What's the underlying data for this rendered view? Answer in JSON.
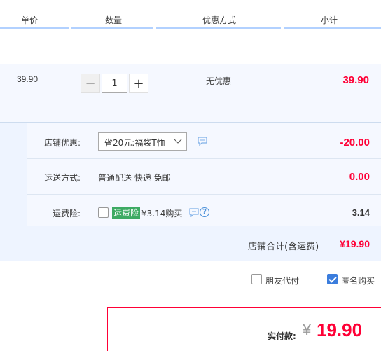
{
  "header": {
    "col_unit_price": "单价",
    "col_quantity": "数量",
    "col_discount": "优惠方式",
    "col_subtotal": "小计"
  },
  "item": {
    "unit_price": "39.90",
    "quantity": "1",
    "minus_label": "−",
    "plus_label": "+",
    "discount": "无优惠",
    "subtotal": "39.90"
  },
  "shop": {
    "coupon_label": "店铺优惠:",
    "coupon_selected": "省20元:福袋T恤",
    "coupon_amount": "-20.00",
    "shipping_label": "运送方式:",
    "shipping_method": "普通配送 快递 免邮",
    "shipping_amount": "0.00",
    "insurance_label": "运费险:",
    "insurance_badge": "运费险",
    "insurance_text": "¥3.14购买",
    "insurance_help": "?",
    "insurance_amount": "3.14",
    "total_label": "店铺合计(含运费)",
    "total_amount": "¥19.90"
  },
  "options": {
    "friend_pay": "朋友代付",
    "friend_pay_checked": false,
    "anonymous": "匿名购买",
    "anonymous_checked": true
  },
  "payment": {
    "label": "实付款:",
    "currency": "¥",
    "amount": "19.90"
  },
  "colors": {
    "price_red": "#ff0036",
    "header_line": "#b2d1ff",
    "insurance_green": "#3daa63",
    "checkbox_blue": "#3b7ddd"
  },
  "icons": [
    "chat-icon",
    "help-icon",
    "chevron-down-icon",
    "check-icon"
  ]
}
